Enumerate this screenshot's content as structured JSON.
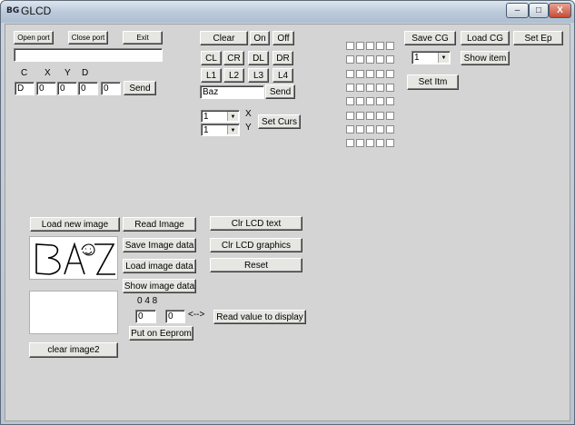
{
  "window": {
    "title": "GLCD",
    "icon_text": "BG",
    "minimize": "–",
    "maximize": "□",
    "close": "X"
  },
  "port": {
    "open_label": "Open port",
    "close_label": "Close port",
    "exit_label": "Exit",
    "status_value": ""
  },
  "text_area": {
    "headers": [
      "C",
      "X",
      "Y",
      "D"
    ],
    "values": [
      "D",
      "0",
      "0",
      "0",
      "0"
    ],
    "send_label": "Send"
  },
  "lcd": {
    "clear_label": "Clear",
    "on_label": "On",
    "off_label": "Off",
    "dir_buttons": [
      "CL",
      "CR",
      "DL",
      "DR"
    ],
    "line_buttons": [
      "L1",
      "L2",
      "L3",
      "L4"
    ],
    "text_value": "Baz",
    "send_label": "Send",
    "x_value": "1",
    "y_value": "1",
    "x_label": "X",
    "y_label": "Y",
    "set_cursor_label": "Set Curs"
  },
  "custom_glyph": {
    "save_label": "Save CG",
    "load_label": "Load CG",
    "set_ep_label": "Set Ep",
    "item_value": "1",
    "show_item_label": "Show item",
    "set_item_label": "Set Itm"
  },
  "image": {
    "load_new_label": "Load new image",
    "read_label": "Read Image",
    "save_data_label": "Save Image data",
    "load_data_label": "Load image data",
    "show_data_label": "Show image data",
    "preview_text": "BAZ",
    "clear_image2_label": "clear image2",
    "number_label": "0 4 8",
    "value_a": "0",
    "value_b": "0",
    "arrow_label": "<-->",
    "read_value_label": "Read value to display",
    "put_eeprom_label": "Put on Eeprom"
  },
  "lcd_ops": {
    "clr_text_label": "Clr LCD text",
    "clr_graphics_label": "Clr LCD graphics",
    "reset_label": "Reset"
  },
  "checkbox_grid": {
    "rows": 8,
    "cols": 5
  }
}
